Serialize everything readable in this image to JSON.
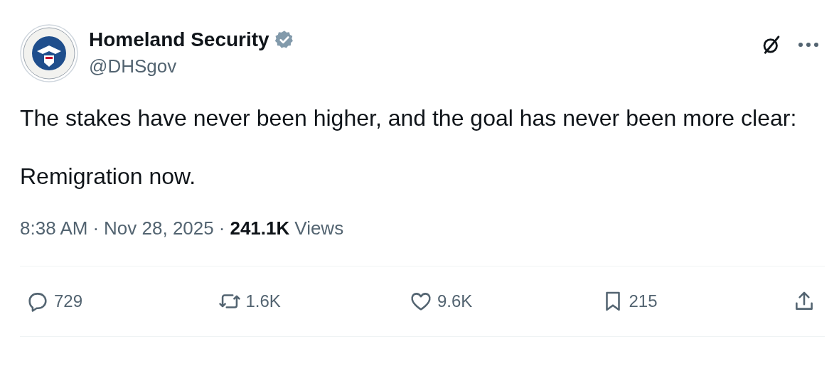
{
  "author": {
    "name": "Homeland Security",
    "handle": "@DHSgov",
    "verified": true
  },
  "paragraphs": [
    "The stakes have never been higher, and the goal has never been more clear:",
    "Remigration now."
  ],
  "meta": {
    "time": "8:38 AM",
    "separator": "·",
    "date": "Nov 28, 2025",
    "views_count": "241.1K",
    "views_label": "Views"
  },
  "actions": [
    {
      "kind": "reply",
      "count": "729"
    },
    {
      "kind": "repost",
      "count": "1.6K"
    },
    {
      "kind": "like",
      "count": "9.6K"
    },
    {
      "kind": "bookmark",
      "count": "215"
    },
    {
      "kind": "share"
    }
  ]
}
